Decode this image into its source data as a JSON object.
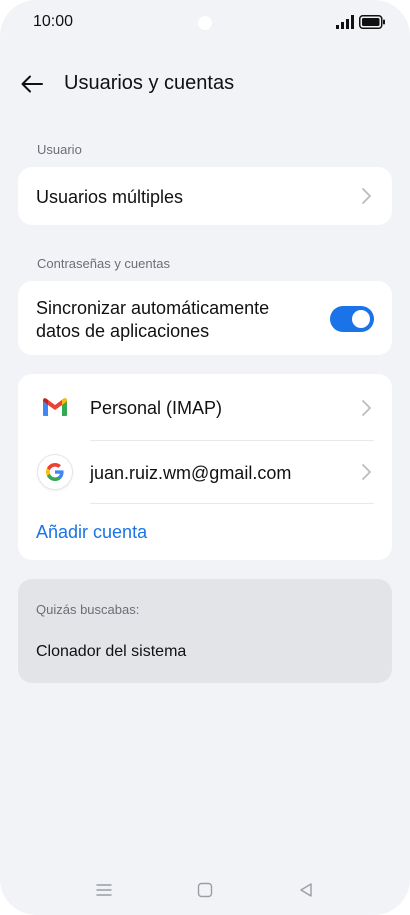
{
  "status": {
    "time": "10:00"
  },
  "header": {
    "title": "Usuarios y cuentas"
  },
  "sections": {
    "user_label": "Usuario",
    "multi_users": "Usuarios múltiples",
    "accounts_label": "Contraseñas y cuentas",
    "auto_sync": "Sincronizar automáticamente datos de aplicaciones",
    "auto_sync_on": true
  },
  "accounts": [
    {
      "label": "Personal (IMAP)",
      "icon": "gmail-icon"
    },
    {
      "label": "juan.ruiz.wm@gmail.com",
      "icon": "google-icon"
    }
  ],
  "add_account": "Añadir cuenta",
  "suggestions": {
    "label": "Quizás buscabas:",
    "item": "Clonador del sistema"
  },
  "colors": {
    "accent": "#1a73e8",
    "background": "#f1f3f6",
    "card": "#ffffff",
    "suggest_card": "#e2e4e7"
  }
}
